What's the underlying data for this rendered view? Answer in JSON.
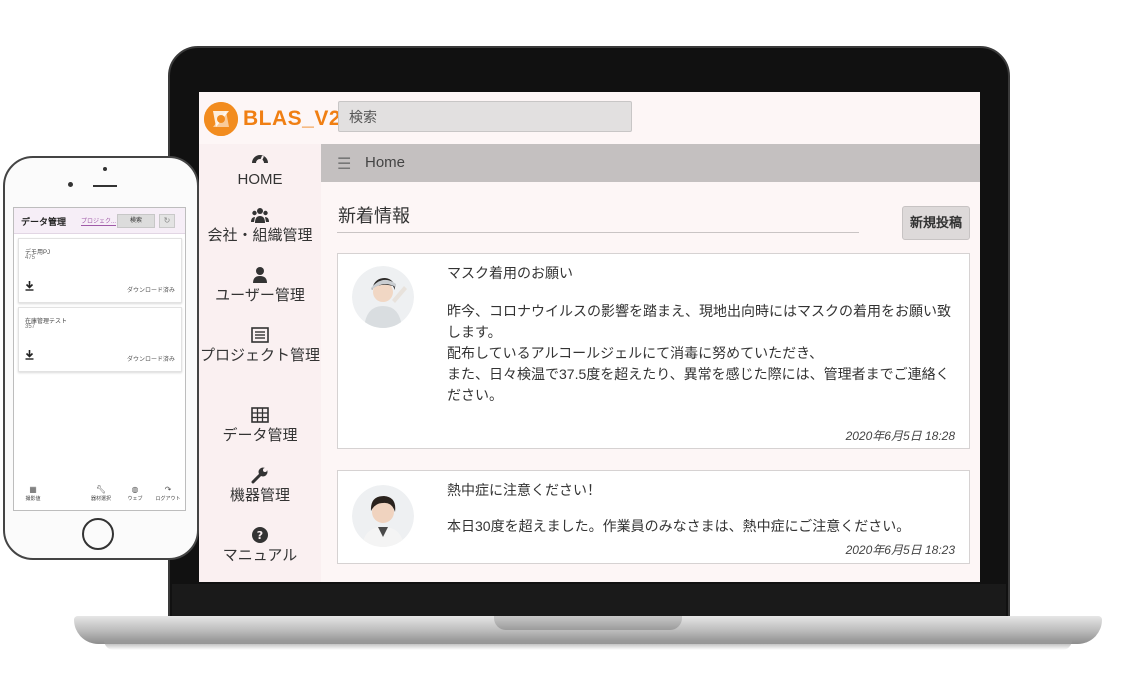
{
  "app": {
    "logo_text": "BLAS_V2",
    "search_placeholder": "検索",
    "brand_color": "#f28c1f"
  },
  "sidebar": {
    "items": [
      {
        "label": "HOME",
        "icon": "dashboard-icon"
      },
      {
        "label": "会社・組織管理",
        "icon": "users-icon"
      },
      {
        "label": "ユーザー管理",
        "icon": "user-icon"
      },
      {
        "label": "プロジェクト管理",
        "icon": "list-icon"
      },
      {
        "label": "データ管理",
        "icon": "table-icon"
      },
      {
        "label": "機器管理",
        "icon": "wrench-icon"
      },
      {
        "label": "マニュアル",
        "icon": "question-icon"
      }
    ]
  },
  "topbar": {
    "breadcrumb": "Home"
  },
  "main": {
    "section_title": "新着情報",
    "new_post_label": "新規投稿",
    "posts": [
      {
        "title": "マスク着用のお願い",
        "body": [
          "昨今、コロナウイルスの影響を踏まえ、現地出向時にはマスクの着用をお願い致します。",
          "配布しているアルコールジェルにて消毒に努めていただき、",
          "また、日々検温で37.5度を超えたり、異常を感じた際には、管理者までご連絡ください。"
        ],
        "date": "2020年6月5日",
        "time": "18:28"
      },
      {
        "title": "熱中症に注意ください！",
        "body": [
          "本日30度を超えました。作業員のみなさまは、熱中症にご注意ください。"
        ],
        "date": "2020年6月5日",
        "time": "18:23"
      }
    ]
  },
  "phone": {
    "title": "データ管理",
    "tab": "プロジェク...",
    "search_label": "検索",
    "cards": [
      {
        "name": "デモ用PJ",
        "count": "475",
        "status": "ダウンロード済み"
      },
      {
        "name": "在庫管理テスト",
        "count": "357",
        "status": "ダウンロード済み"
      }
    ],
    "nav": [
      {
        "label": "撮影値",
        "icon": "grid-icon"
      },
      {
        "label": "",
        "icon": "blank"
      },
      {
        "label": "器材選択",
        "icon": "wrench-icon"
      },
      {
        "label": "ウェブ",
        "icon": "globe-icon"
      },
      {
        "label": "ログアウト",
        "icon": "logout-icon"
      }
    ]
  }
}
